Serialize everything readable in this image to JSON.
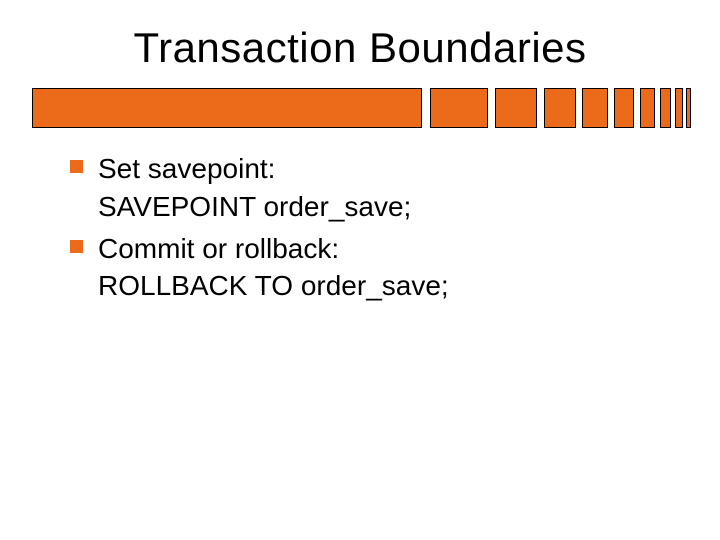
{
  "title": "Transaction Boundaries",
  "colors": {
    "accent": "#eb6b1a"
  },
  "bullets": [
    {
      "heading": "Set savepoint:",
      "code": "SAVEPOINT order_save;"
    },
    {
      "heading": "Commit or rollback:",
      "code": "ROLLBACK TO order_save;"
    }
  ]
}
